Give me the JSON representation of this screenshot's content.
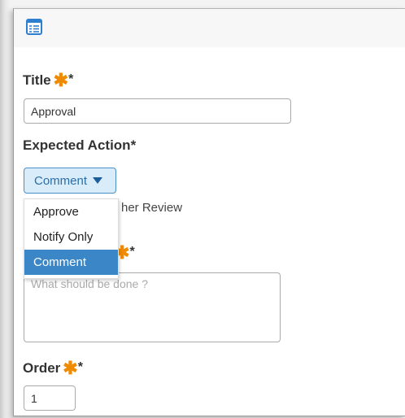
{
  "form": {
    "title_label": "Title",
    "title_required_mark": "*",
    "title_value": "Approval",
    "expected_action_label": "Expected Action*",
    "expected_action_selected": "Comment",
    "expected_action_options": [
      "Approve",
      "Notify Only",
      "Comment"
    ],
    "hidden_option_fragment": "her Review",
    "description_required_mark": "*",
    "description_placeholder": "What should be done ?",
    "order_label": "Order",
    "order_required_mark": "*",
    "order_value": "1"
  },
  "colors": {
    "accent": "#3b86c6",
    "required_star": "#f08a00",
    "select_bg": "#d9ecfa",
    "select_text": "#2a6ea8"
  },
  "icons": {
    "header": "list-form-icon",
    "required": "required-star-icon",
    "dropdown": "caret-down-icon"
  }
}
